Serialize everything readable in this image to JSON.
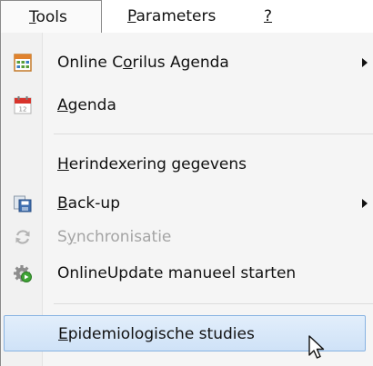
{
  "menubar": {
    "items": [
      {
        "pre": "",
        "mnemonic": "T",
        "post": "ools"
      },
      {
        "pre": "",
        "mnemonic": "P",
        "post": "arameters"
      },
      {
        "pre": "",
        "mnemonic": "?",
        "post": ""
      }
    ],
    "active_index": 0
  },
  "menu": {
    "items": [
      {
        "pre": "Online C",
        "mnemonic": "o",
        "post": "rilus Agenda",
        "icon": "calendar-grid-icon",
        "submenu": true,
        "enabled": true
      },
      {
        "pre": "",
        "mnemonic": "A",
        "post": "genda",
        "icon": "calendar-icon",
        "submenu": false,
        "enabled": true
      },
      {
        "pre": "",
        "mnemonic": "H",
        "post": "erindexering gegevens",
        "icon": "",
        "submenu": false,
        "enabled": true
      },
      {
        "pre": "",
        "mnemonic": "B",
        "post": "ack-up",
        "icon": "backup-icon",
        "submenu": true,
        "enabled": true
      },
      {
        "pre": "S",
        "mnemonic": "y",
        "post": "nchronisatie",
        "icon": "sync-icon",
        "submenu": false,
        "enabled": false
      },
      {
        "pre": "OnlineUpdate manueel starten",
        "mnemonic": "",
        "post": "",
        "icon": "update-gear-icon",
        "submenu": false,
        "enabled": true
      },
      {
        "pre": "",
        "mnemonic": "E",
        "post": "pidemiologische studies",
        "icon": "",
        "submenu": false,
        "enabled": true,
        "highlighted": true
      }
    ]
  },
  "colors": {
    "highlight_fill": "#d7e7f9",
    "highlight_border": "#88b3e2",
    "disabled_text": "#a4a4a4"
  }
}
